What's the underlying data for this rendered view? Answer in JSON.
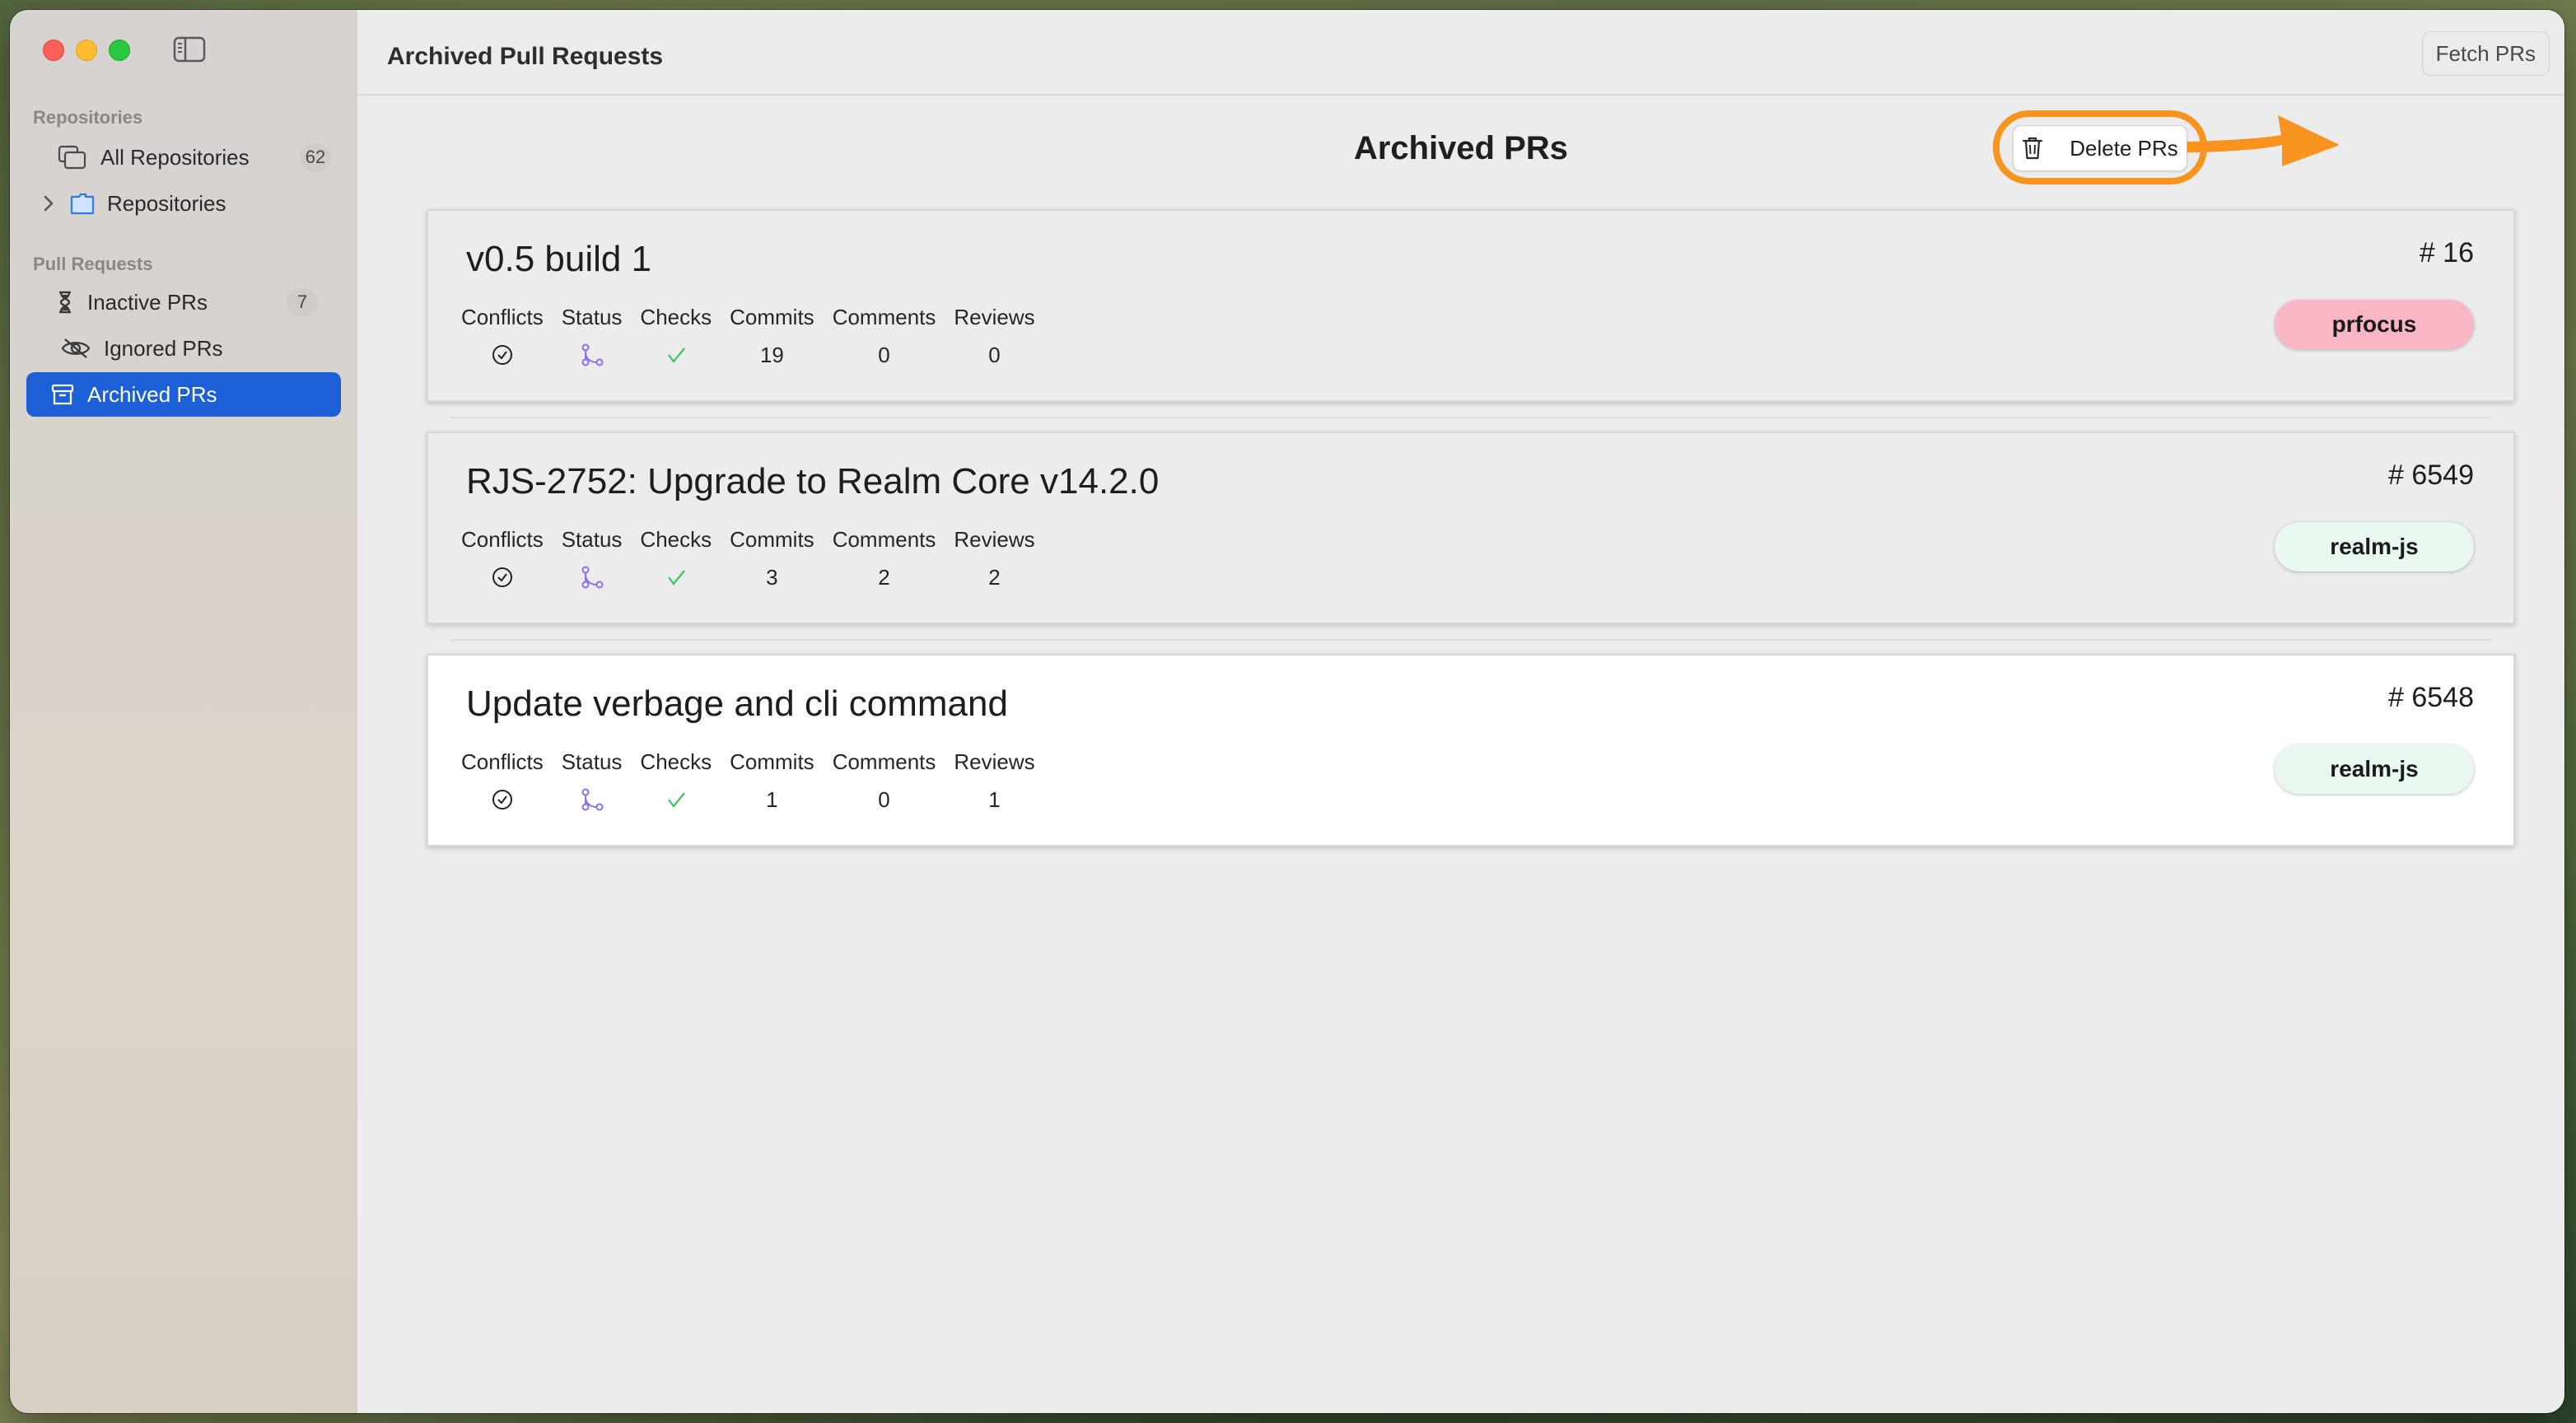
{
  "window": {
    "toolbar_title": "Archived Pull Requests",
    "fetch_label": "Fetch PRs"
  },
  "sidebar": {
    "repositories_section": "Repositories",
    "all_repositories": {
      "label": "All Repositories",
      "count": "62"
    },
    "repositories_group": {
      "label": "Repositories"
    },
    "pull_requests_section": "Pull Requests",
    "inactive": {
      "label": "Inactive PRs",
      "count": "7"
    },
    "ignored": {
      "label": "Ignored PRs"
    },
    "archived": {
      "label": "Archived PRs",
      "active": true
    }
  },
  "main": {
    "heading": "Archived PRs",
    "delete_label": "Delete PRs",
    "stat_labels": [
      "Conflicts",
      "Status",
      "Checks",
      "Commits",
      "Comments",
      "Reviews"
    ],
    "prs": [
      {
        "title": "v0.5 build 1",
        "number": "# 16",
        "commits": "19",
        "comments": "0",
        "reviews": "0",
        "repo": "prfocus",
        "repo_color": "#f9b6c4"
      },
      {
        "title": "RJS-2752: Upgrade to Realm Core v14.2.0",
        "number": "# 6549",
        "commits": "3",
        "comments": "2",
        "reviews": "2",
        "repo": "realm-js",
        "repo_color": "#e8f8ee"
      },
      {
        "title": "Update verbage and cli command",
        "number": "# 6548",
        "commits": "1",
        "comments": "0",
        "reviews": "1",
        "repo": "realm-js",
        "repo_color": "#e8f8ee"
      }
    ]
  },
  "colors": {
    "accent": "#1d5fd6",
    "highlight": "#f7931e",
    "check_green": "#34c759",
    "status_purple": "#8e6ee8"
  }
}
